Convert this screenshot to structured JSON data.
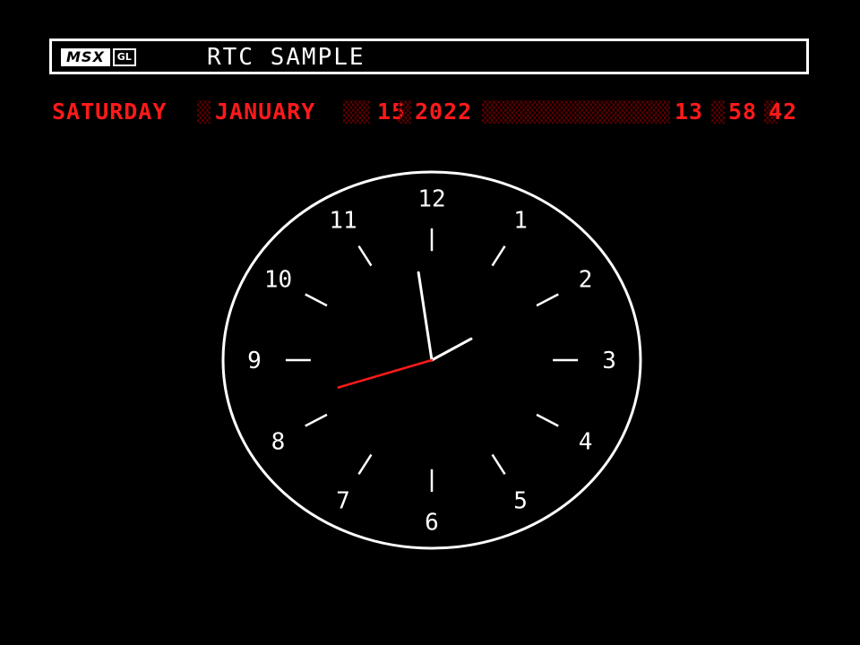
{
  "header": {
    "logo_text": "MSX",
    "logo_badge": "GL",
    "title": "RTC SAMPLE"
  },
  "date_strip": {
    "weekday": "SATURDAY",
    "month": "JANUARY",
    "day": "15",
    "year": "2022",
    "hour": "13",
    "minute": "58",
    "second": "42",
    "colors": {
      "active": "#ff1a1a",
      "padding": "#5a0000"
    }
  },
  "clock": {
    "numerals": [
      "12",
      "1",
      "2",
      "3",
      "4",
      "5",
      "6",
      "7",
      "8",
      "9",
      "10",
      "11"
    ],
    "hands": {
      "hour": 13,
      "minute": 58,
      "second": 42
    },
    "colors": {
      "face": "#ffffff",
      "hour_hand": "#ffffff",
      "minute_hand": "#ffffff",
      "second_hand": "#ff1a1a"
    }
  }
}
